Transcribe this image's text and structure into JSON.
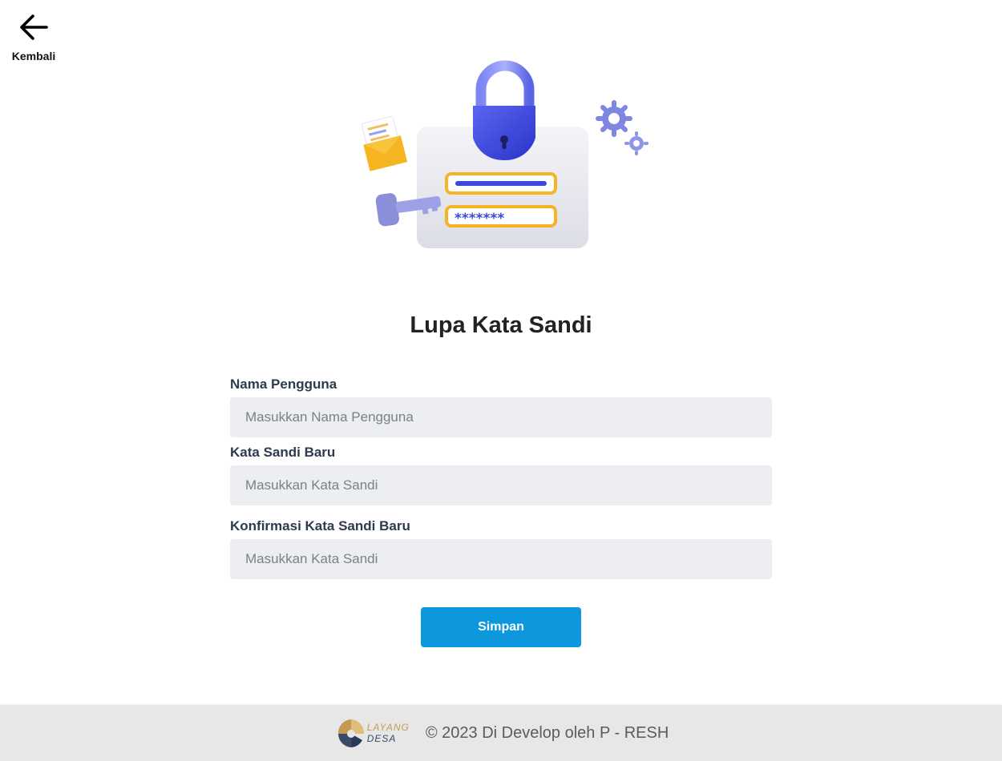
{
  "back": {
    "label": "Kembali",
    "icon": "arrow-left-icon"
  },
  "title": "Lupa Kata Sandi",
  "form": {
    "username": {
      "label": "Nama Pengguna",
      "placeholder": "Masukkan Nama Pengguna",
      "value": ""
    },
    "new_password": {
      "label": "Kata Sandi Baru",
      "placeholder": "Masukkan Kata Sandi",
      "value": ""
    },
    "confirm_password": {
      "label": "Konfirmasi Kata Sandi Baru",
      "placeholder": "Masukkan Kata Sandi",
      "value": ""
    },
    "submit_label": "Simpan"
  },
  "footer": {
    "logo": {
      "line1": "LAYANG",
      "line2": "DESA"
    },
    "copyright": "© 2023 Di Develop oleh P - RESH"
  },
  "colors": {
    "primary_button": "#0d97dd",
    "input_background": "#eceef1",
    "footer_background": "#e7e7e7",
    "lock_blue": "#3b48e0",
    "key_purple": "#8b8fd9",
    "field_orange": "#f6b324"
  }
}
